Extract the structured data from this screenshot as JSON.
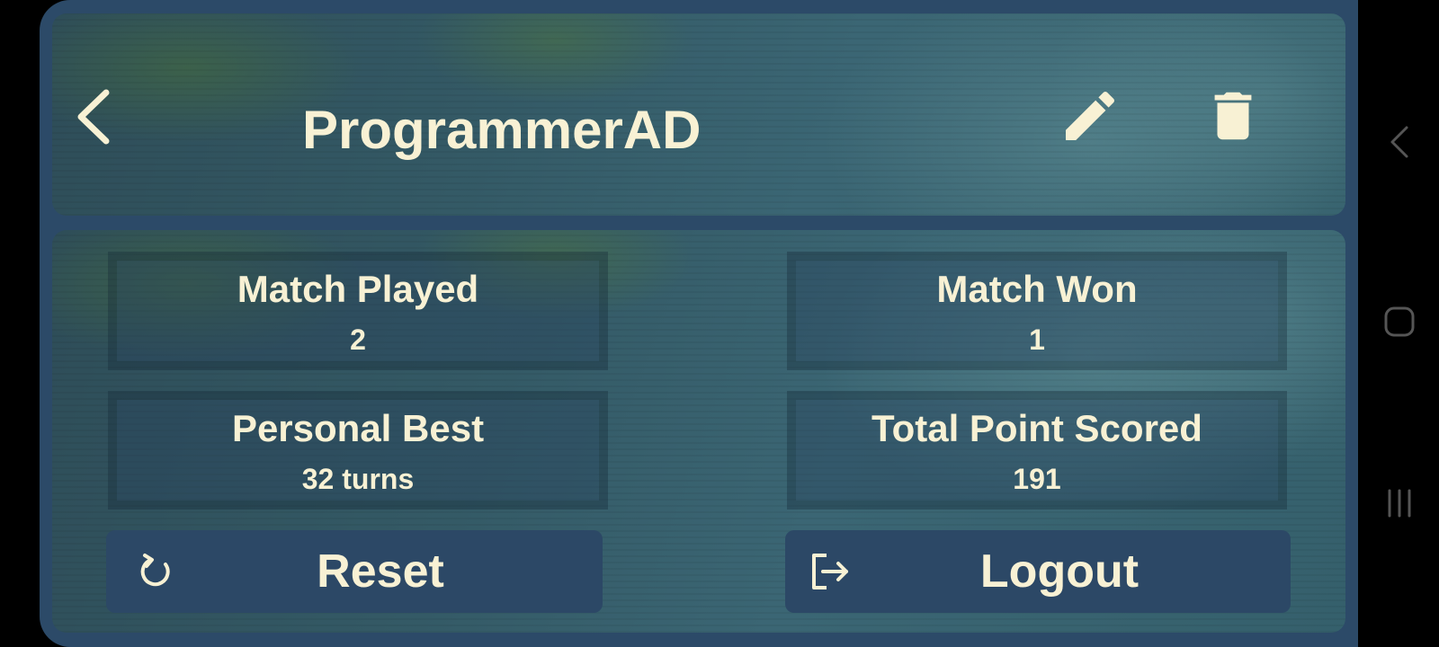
{
  "header": {
    "title": "ProgrammerAD",
    "icons": {
      "back": "chevron-left-icon",
      "edit": "pencil-icon",
      "delete": "trash-icon"
    }
  },
  "stats": {
    "match_played": {
      "label": "Match Played",
      "value": "2"
    },
    "match_won": {
      "label": "Match Won",
      "value": "1"
    },
    "personal_best": {
      "label": "Personal Best",
      "value": "32 turns"
    },
    "total_points": {
      "label": "Total Point Scored",
      "value": "191"
    }
  },
  "actions": {
    "reset": {
      "label": "Reset",
      "icon": "refresh-icon"
    },
    "logout": {
      "label": "Logout",
      "icon": "logout-icon"
    }
  },
  "system_nav": {
    "icons": [
      "back-nav-icon",
      "home-nav-icon",
      "recents-nav-icon"
    ]
  },
  "colors": {
    "frame": "#2c4a68",
    "text": "#f8f1d4",
    "button": "#2c4866"
  }
}
